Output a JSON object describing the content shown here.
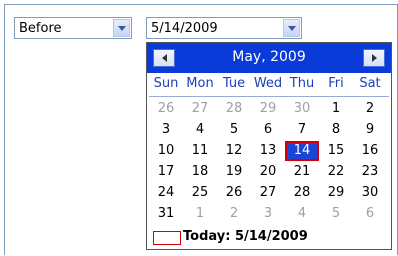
{
  "filter": {
    "operator_select": {
      "value": "Before"
    },
    "date_select": {
      "value": "5/14/2009"
    }
  },
  "calendar": {
    "month_label": "May, 2009",
    "weekdays": [
      "Sun",
      "Mon",
      "Tue",
      "Wed",
      "Thu",
      "Fri",
      "Sat"
    ],
    "weeks": [
      [
        {
          "d": "26",
          "o": true
        },
        {
          "d": "27",
          "o": true
        },
        {
          "d": "28",
          "o": true
        },
        {
          "d": "29",
          "o": true
        },
        {
          "d": "30",
          "o": true
        },
        {
          "d": "1"
        },
        {
          "d": "2"
        }
      ],
      [
        {
          "d": "3"
        },
        {
          "d": "4"
        },
        {
          "d": "5"
        },
        {
          "d": "6"
        },
        {
          "d": "7"
        },
        {
          "d": "8"
        },
        {
          "d": "9"
        }
      ],
      [
        {
          "d": "10"
        },
        {
          "d": "11"
        },
        {
          "d": "12"
        },
        {
          "d": "13"
        },
        {
          "d": "14",
          "sel": true
        },
        {
          "d": "15"
        },
        {
          "d": "16"
        }
      ],
      [
        {
          "d": "17"
        },
        {
          "d": "18"
        },
        {
          "d": "19"
        },
        {
          "d": "20"
        },
        {
          "d": "21"
        },
        {
          "d": "22"
        },
        {
          "d": "23"
        }
      ],
      [
        {
          "d": "24"
        },
        {
          "d": "25"
        },
        {
          "d": "26"
        },
        {
          "d": "27"
        },
        {
          "d": "28"
        },
        {
          "d": "29"
        },
        {
          "d": "30"
        }
      ],
      [
        {
          "d": "31"
        },
        {
          "d": "1",
          "o": true
        },
        {
          "d": "2",
          "o": true
        },
        {
          "d": "3",
          "o": true
        },
        {
          "d": "4",
          "o": true
        },
        {
          "d": "5",
          "o": true
        },
        {
          "d": "6",
          "o": true
        }
      ]
    ],
    "today_label": "Today: 5/14/2009"
  },
  "colors": {
    "header_bg": "#0a3ad8",
    "weekday_text": "#1b3fb7",
    "selected_bg": "#1a45d6",
    "selected_border": "#d40000",
    "other_month_text": "#a0a0a0"
  }
}
